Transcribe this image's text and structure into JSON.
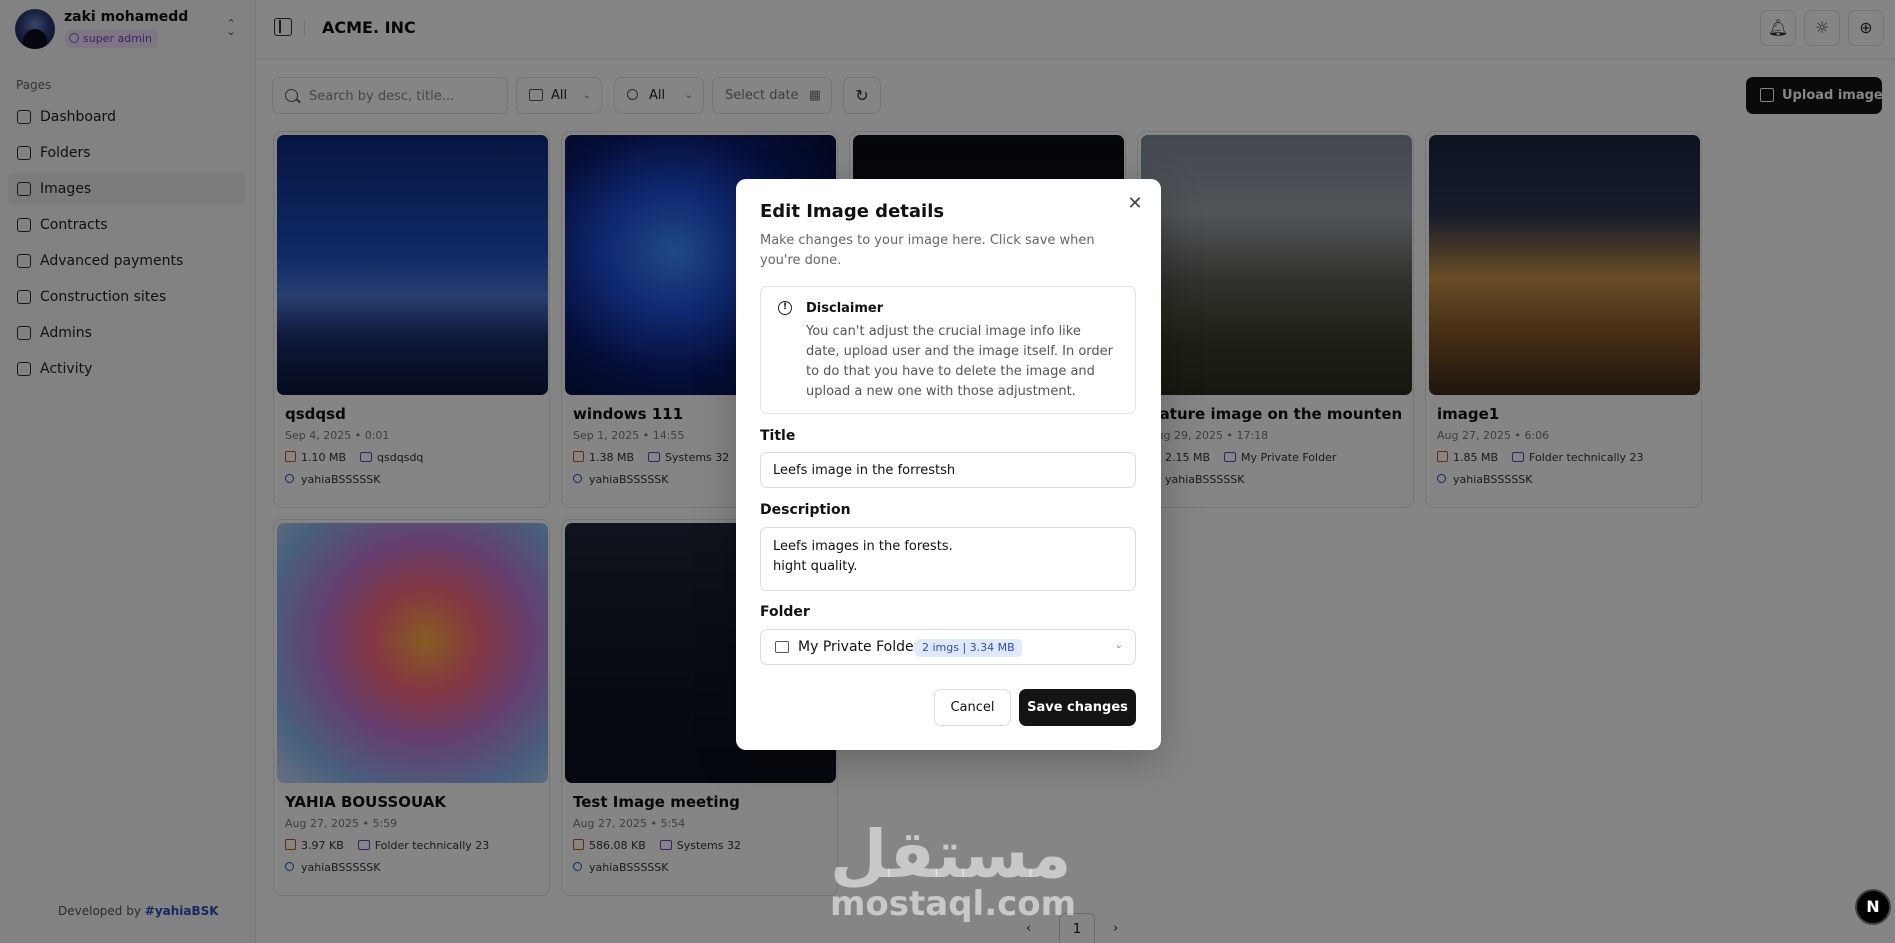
{
  "user": {
    "name": "zaki mohamedd",
    "role": "super admin"
  },
  "sidebar": {
    "section_label": "Pages",
    "items": [
      {
        "label": "Dashboard",
        "icon": "dashboard-icon"
      },
      {
        "label": "Folders",
        "icon": "folders-icon"
      },
      {
        "label": "Images",
        "icon": "images-icon",
        "active": true
      },
      {
        "label": "Contracts",
        "icon": "contracts-icon"
      },
      {
        "label": "Advanced payments",
        "icon": "wallet-icon"
      },
      {
        "label": "Construction sites",
        "icon": "construction-icon"
      },
      {
        "label": "Admins",
        "icon": "admins-icon"
      },
      {
        "label": "Activity",
        "icon": "activity-icon"
      }
    ],
    "credit_prefix": "Developed by",
    "credit_handle": "#yahiaBSK"
  },
  "header": {
    "company": "ACME. INC"
  },
  "toolbar": {
    "search_placeholder": "Search by desc, title...",
    "folder_filter": "All",
    "user_filter": "All",
    "date_placeholder": "Select date",
    "upload_label": "Upload image"
  },
  "cards": [
    {
      "title": "qsdqsd",
      "date": "Sep 4, 2025 • 0:01",
      "size": "1.10 MB",
      "folder": "qsdqsdq",
      "user": "yahiaBSSSSSK"
    },
    {
      "title": "windows 111",
      "date": "Sep 1, 2025 • 14:55",
      "size": "1.38 MB",
      "folder": "Systems 32",
      "user": "yahiaBSSSSSK"
    },
    {
      "title": "",
      "date": "",
      "size": "",
      "folder": "",
      "user": ""
    },
    {
      "title": "nature image on the mounten",
      "date": "Aug 29, 2025 • 17:18",
      "size": "2.15 MB",
      "folder": "My Private Folder",
      "user": "yahiaBSSSSSK"
    },
    {
      "title": "image1",
      "date": "Aug 27, 2025 • 6:06",
      "size": "1.85 MB",
      "folder": "Folder technically 23",
      "user": "yahiaBSSSSSK"
    },
    {
      "title": "YAHIA BOUSSOUAK",
      "date": "Aug 27, 2025 • 5:59",
      "size": "3.97 KB",
      "folder": "Folder technically 23",
      "user": "yahiaBSSSSSK"
    },
    {
      "title": "Test Image meeting",
      "date": "Aug 27, 2025 • 5:54",
      "size": "586.08 KB",
      "folder": "Systems 32",
      "user": "yahiaBSSSSSK"
    }
  ],
  "pagination": {
    "current": "1"
  },
  "watermark": {
    "arabic": "مستقل",
    "latin": "mostaql.com"
  },
  "modal": {
    "title": "Edit Image details",
    "description": "Make changes to your image here. Click save when you're done.",
    "disclaimer_title": "Disclaimer",
    "disclaimer_text": "You can't adjust the crucial image info like date, upload user and the image itself. In order to do that you have to delete the image and upload a new one with those adjustment.",
    "title_label": "Title",
    "title_value": "Leefs image in the forrestsh",
    "description_label": "Description",
    "description_value": "Leefs images in the forests.\nhight quality.",
    "folder_label": "Folder",
    "folder_value": "My Private Folder",
    "folder_badge": "2 imgs | 3.34 MB",
    "cancel_label": "Cancel",
    "save_label": "Save changes"
  },
  "colors": {
    "primary": "#141414",
    "role_badge": "#7b3ec2",
    "link": "#2a4fb8"
  }
}
